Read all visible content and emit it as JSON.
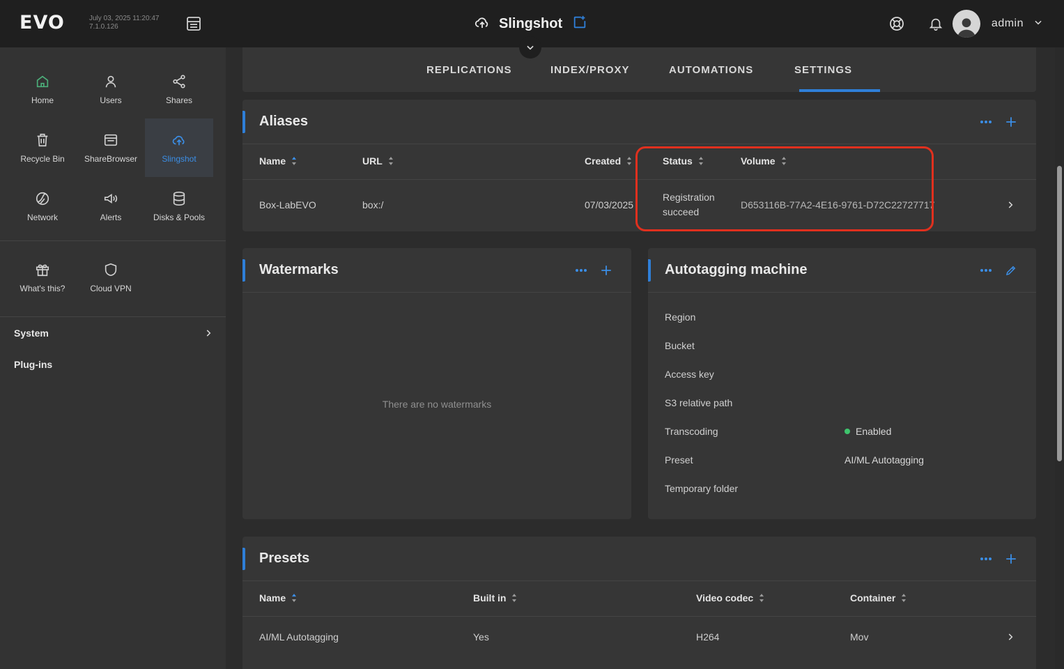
{
  "header": {
    "logo": "EVO",
    "datetime": "July 03, 2025 11:20:47",
    "version": "7.1.0.126",
    "app_title": "Slingshot",
    "user": "admin"
  },
  "sidebar": {
    "apps": [
      {
        "label": "Home",
        "icon": "home-icon"
      },
      {
        "label": "Users",
        "icon": "user-icon"
      },
      {
        "label": "Shares",
        "icon": "share-icon"
      },
      {
        "label": "Recycle Bin",
        "icon": "trash-icon"
      },
      {
        "label": "ShareBrowser",
        "icon": "browser-icon"
      },
      {
        "label": "Slingshot",
        "icon": "cloud-upload-icon"
      },
      {
        "label": "Network",
        "icon": "network-icon"
      },
      {
        "label": "Alerts",
        "icon": "megaphone-icon"
      },
      {
        "label": "Disks & Pools",
        "icon": "database-icon"
      }
    ],
    "extras": [
      {
        "label": "What's this?",
        "icon": "gift-icon"
      },
      {
        "label": "Cloud VPN",
        "icon": "shield-icon"
      }
    ],
    "menu": {
      "system": "System",
      "plugins": "Plug-ins"
    }
  },
  "tabs": [
    "REPLICATIONS",
    "INDEX/PROXY",
    "AUTOMATIONS",
    "SETTINGS"
  ],
  "active_tab": "SETTINGS",
  "aliases": {
    "title": "Aliases",
    "columns": [
      "Name",
      "URL",
      "Created",
      "Status",
      "Volume"
    ],
    "rows": [
      {
        "name": "Box-LabEVO",
        "url": "box:/",
        "created": "07/03/2025",
        "status_line1": "Registration",
        "status_line2": "succeed",
        "volume": "D653116B-77A2-4E16-9761-D72C22727717"
      }
    ]
  },
  "watermarks": {
    "title": "Watermarks",
    "empty": "There are no watermarks"
  },
  "autotagging": {
    "title": "Autotagging machine",
    "labels": [
      "Region",
      "Bucket",
      "Access key",
      "S3 relative path",
      "Transcoding",
      "Preset",
      "Temporary folder"
    ],
    "transcoding_value": "Enabled",
    "preset_value": "AI/ML Autotagging"
  },
  "presets": {
    "title": "Presets",
    "columns": [
      "Name",
      "Built in",
      "Video codec",
      "Container"
    ],
    "rows": [
      {
        "name": "AI/ML Autotagging",
        "built_in": "Yes",
        "video_codec": "H264",
        "container": "Mov"
      }
    ]
  },
  "colors": {
    "accent": "#2f7fd8",
    "highlight": "#e0301e",
    "enabled": "#3ec46d",
    "home_icon": "#4caf7a"
  }
}
